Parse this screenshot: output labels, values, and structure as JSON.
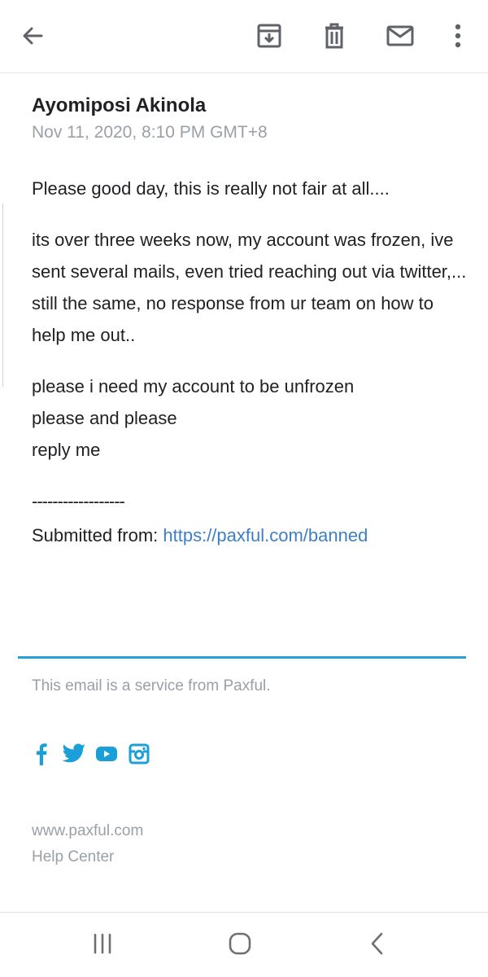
{
  "toolbar": {
    "back_icon": "arrow-left-icon",
    "archive_icon": "archive-icon",
    "delete_icon": "trash-icon",
    "mark_unread_icon": "envelope-icon",
    "more_icon": "more-vertical-icon"
  },
  "email": {
    "sender": "Ayomiposi Akinola",
    "date": "Nov 11, 2020, 8:10 PM GMT+8",
    "paragraphs": [
      "Please good day, this is really not fair at all....",
      "its over three weeks now, my account was frozen, ive sent several mails, even tried reaching out via twitter,... still the same, no response from ur team on how to help me out..",
      "please i need my account to be unfrozen\nplease and please\nreply me"
    ],
    "separator": "------------------",
    "submitted_label": "Submitted from: ",
    "submitted_link": "https://paxful.com/banned"
  },
  "footer": {
    "note": "This email is a service from Paxful.",
    "social": [
      "facebook-icon",
      "twitter-icon",
      "youtube-icon",
      "instagram-icon"
    ],
    "website": "www.paxful.com",
    "help_center": "Help Center"
  },
  "colors": {
    "accent": "#27a0d8",
    "link": "#3d7fc7",
    "muted": "#9aa0a6",
    "icon": "#5f6368",
    "social": "#1a9fd9"
  },
  "navbar": {
    "recents_icon": "recents-icon",
    "home_icon": "home-icon",
    "back_icon": "back-chevron-icon"
  }
}
